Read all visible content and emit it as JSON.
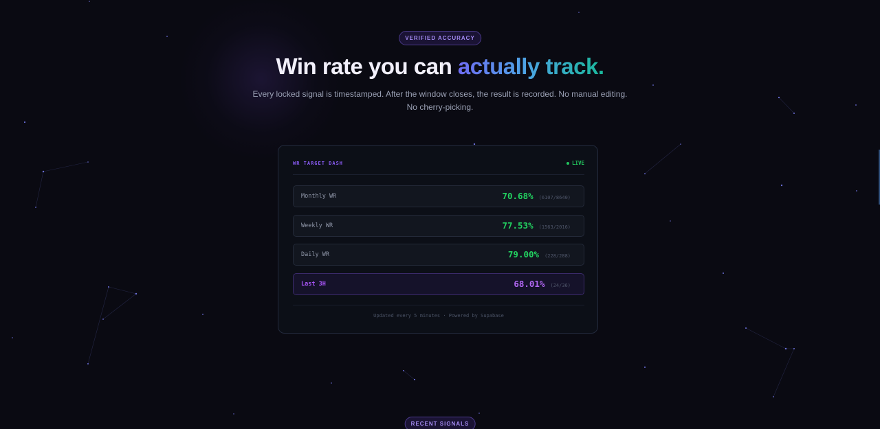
{
  "top_badge": "VERIFIED ACCURACY",
  "headline": {
    "plain": "Win rate you can ",
    "highlight": "actually track."
  },
  "subtitle": "Every locked signal is timestamped. After the window closes, the result is recorded. No manual editing. No cherry-picking.",
  "card": {
    "title": "WR TARGET DASH",
    "live_label": "LIVE",
    "rows": [
      {
        "label": "Monthly WR",
        "percent": "70.68%",
        "count": "(6107/8640)"
      },
      {
        "label": "Weekly WR",
        "percent": "77.53%",
        "count": "(1563/2016)"
      },
      {
        "label": "Daily WR",
        "percent": "79.00%",
        "count": "(228/288)"
      },
      {
        "label": "Last 3H",
        "percent": "68.01%",
        "count": "(24/36)"
      }
    ],
    "footer": "Updated every 5 minutes · Powered by Supabase"
  },
  "bottom_badge": "RECENT SIGNALS",
  "colors": {
    "background": "#0a0a12",
    "accent_purple": "#8b5cf6",
    "accent_green": "#22c55e",
    "gradient_start": "#6f6cf4",
    "gradient_end": "#19b89a"
  }
}
